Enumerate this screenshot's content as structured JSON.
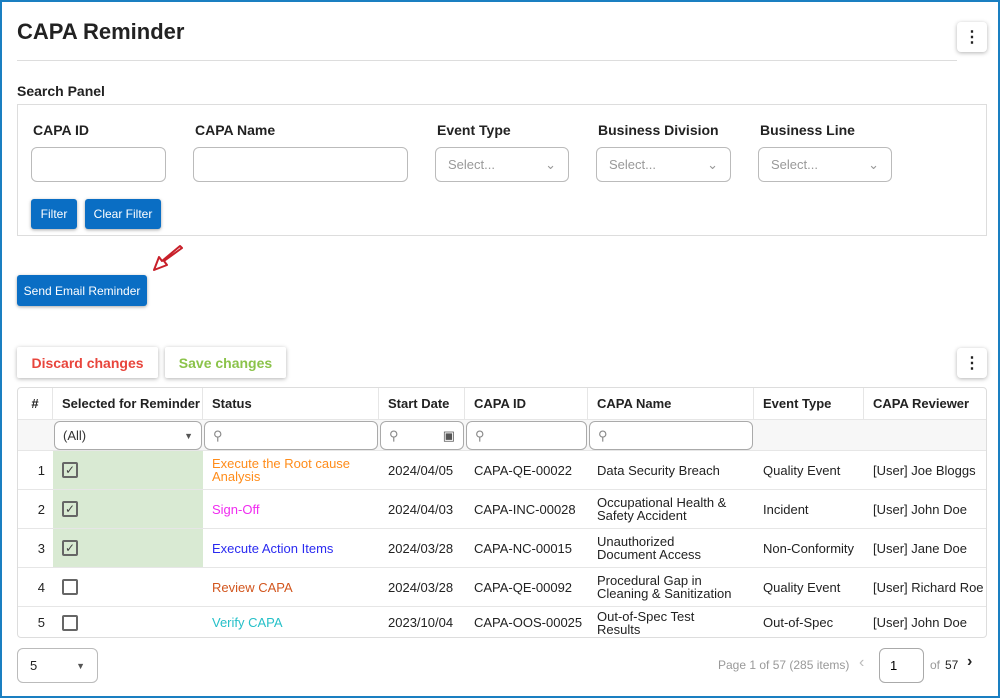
{
  "title": "CAPA Reminder",
  "search_panel": {
    "title": "Search Panel",
    "fields": [
      {
        "label": "CAPA ID",
        "value": ""
      },
      {
        "label": "CAPA Name",
        "value": ""
      }
    ],
    "dropdowns": [
      {
        "label": "Event Type",
        "placeholder": "Select..."
      },
      {
        "label": "Business Division",
        "placeholder": "Select..."
      },
      {
        "label": "Business Line",
        "placeholder": "Select..."
      }
    ],
    "filter_label": "Filter",
    "clear_filter_label": "Clear Filter"
  },
  "send_email_label": "Send Email Reminder",
  "discard_label": "Discard changes",
  "save_label": "Save changes",
  "colors": {
    "primary": "#0a6ec4",
    "discard": "#e8453c",
    "save": "#8bc34a",
    "selected_bg": "#d9ead3"
  },
  "table": {
    "columns": [
      "#",
      "Selected for Reminder",
      "Status",
      "Start Date",
      "CAPA ID",
      "CAPA Name",
      "Event Type",
      "CAPA Reviewer"
    ],
    "selected_filter": "(All)",
    "rows": [
      {
        "n": "1",
        "selected": true,
        "status": "Execute the Root cause Analysis",
        "status_color": "#ff8c1a",
        "date": "2024/04/05",
        "id": "CAPA-QE-00022",
        "name": "Data Security Breach",
        "type": "Quality Event",
        "reviewer": "[User] Joe Bloggs"
      },
      {
        "n": "2",
        "selected": true,
        "status": "Sign-Off",
        "status_color": "#f02cf0",
        "date": "2024/04/03",
        "id": "CAPA-INC-00028",
        "name": "Occupational Health & Safety Accident",
        "type": "Incident",
        "reviewer": "[User] John Doe"
      },
      {
        "n": "3",
        "selected": true,
        "status": "Execute Action Items",
        "status_color": "#2a2af0",
        "date": "2024/03/28",
        "id": "CAPA-NC-00015",
        "name": "Unauthorized Document Access",
        "type": "Non-Conformity",
        "reviewer": "[User] Jane Doe"
      },
      {
        "n": "4",
        "selected": false,
        "status": "Review CAPA",
        "status_color": "#d2561e",
        "date": "2024/03/28",
        "id": "CAPA-QE-00092",
        "name": "Procedural Gap in Cleaning & Sanitization",
        "type": "Quality Event",
        "reviewer": "[User] Richard Roe"
      },
      {
        "n": "5",
        "selected": false,
        "status": "Verify CAPA",
        "status_color": "#26c0c8",
        "date": "2023/10/04",
        "id": "CAPA-OOS-00025",
        "name": "Out-of-Spec Test Results",
        "type": "Out-of-Spec",
        "reviewer": "[User] John Doe"
      }
    ]
  },
  "pager": {
    "page_size": "5",
    "info": "Page 1 of 57 (285 items)",
    "current": "1",
    "of": "of",
    "total": "57"
  }
}
